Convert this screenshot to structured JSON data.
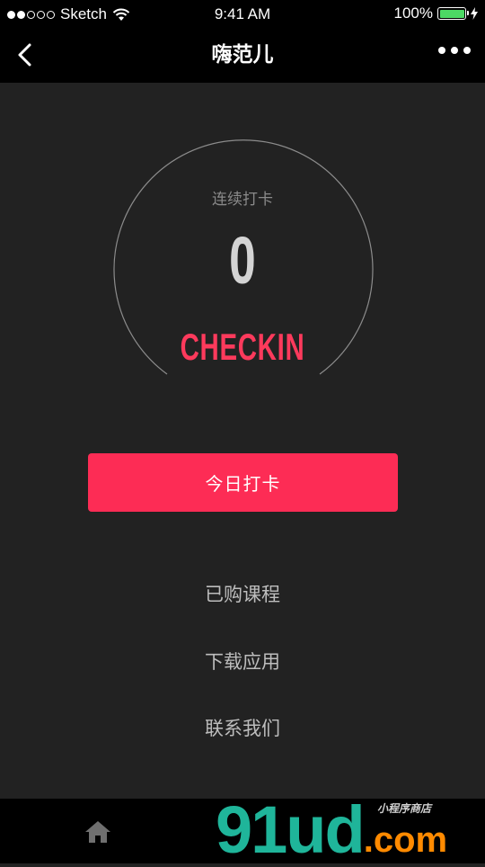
{
  "status_bar": {
    "carrier": "Sketch",
    "signal_filled": 2,
    "signal_total": 5,
    "time": "9:41 AM",
    "battery": "100%",
    "battery_level": 1.0,
    "battery_color": "#4cd964"
  },
  "nav": {
    "title": "嗨范儿",
    "back_icon": "chevron-left-icon",
    "more_icon": "more-horizontal-icon"
  },
  "checkin": {
    "label": "连续打卡",
    "count": "0",
    "word": "CHECKIN",
    "accent_color": "#fd3a5c"
  },
  "primary_button": {
    "label": "今日打卡",
    "color": "#fd2c55"
  },
  "menu": {
    "items": [
      {
        "label": "已购课程"
      },
      {
        "label": "下载应用"
      },
      {
        "label": "联系我们"
      }
    ]
  },
  "tab_bar": {
    "home_icon": "home-icon"
  },
  "watermark": {
    "main": "91ud",
    "dot": ".",
    "suffix": "com",
    "small": "小程序商店"
  }
}
